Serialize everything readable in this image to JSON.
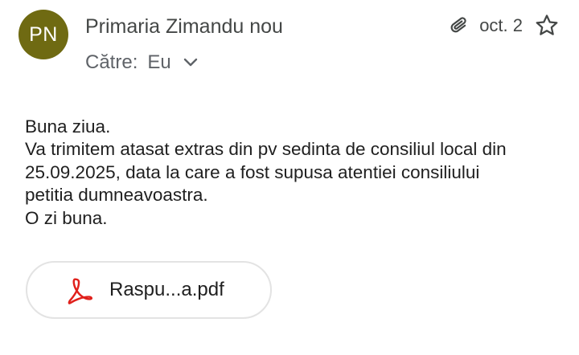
{
  "header": {
    "avatar_initials": "PN",
    "avatar_color": "#6f6a12",
    "sender_name": "Primaria Zimandu nou",
    "to_label": "Către:",
    "to_value": "Eu",
    "date": "oct. 2",
    "icons": {
      "attachment": "paperclip-icon",
      "star": "star-outline-icon",
      "expand": "chevron-down-icon"
    }
  },
  "message": {
    "lines": [
      "Buna ziua.",
      "Va trimitem atasat extras din pv sedinta de consiliul local din",
      "25.09.2025, data la care a fost supusa atentiei consiliului",
      "petitia dumneavoastra.",
      "O zi buna."
    ]
  },
  "attachment": {
    "file_name": "Raspu...a.pdf",
    "icon": "pdf-icon",
    "icon_color": "#e0201b"
  }
}
